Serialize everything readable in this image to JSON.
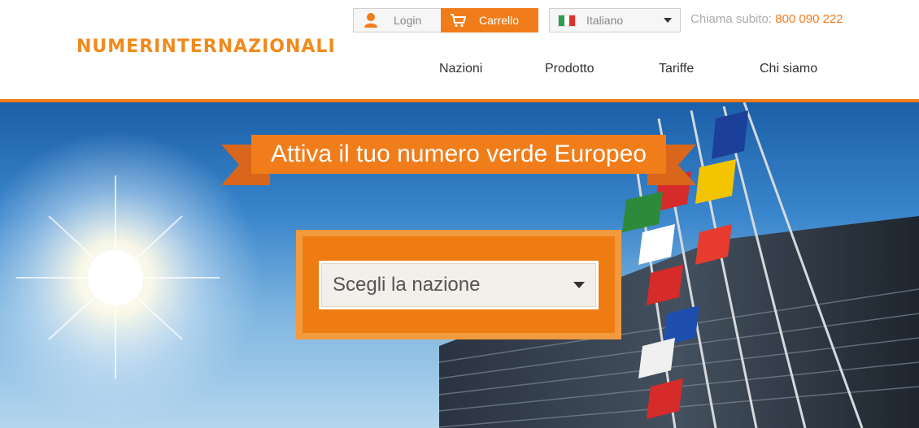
{
  "header": {
    "logo_text": "NUMERINTERNAZIONALI",
    "login_label": "Login",
    "cart_label": "Carrello",
    "language": "Italiano",
    "call_prefix": "Chiama subito:",
    "call_number": "800 090 222"
  },
  "nav": {
    "items": [
      {
        "label": "Nazioni"
      },
      {
        "label": "Prodotto"
      },
      {
        "label": "Tariffe"
      },
      {
        "label": "Chi siamo"
      }
    ]
  },
  "hero": {
    "ribbon_title": "Attiva il tuo numero verde Europeo",
    "country_select_placeholder": "Scegli la nazione"
  },
  "colors": {
    "accent": "#f07d1a",
    "sky": "#2f78c2"
  },
  "icons": {
    "login": "user-icon",
    "cart": "cart-icon",
    "flag": "italy-flag-icon",
    "dropdown": "chevron-down-icon"
  }
}
